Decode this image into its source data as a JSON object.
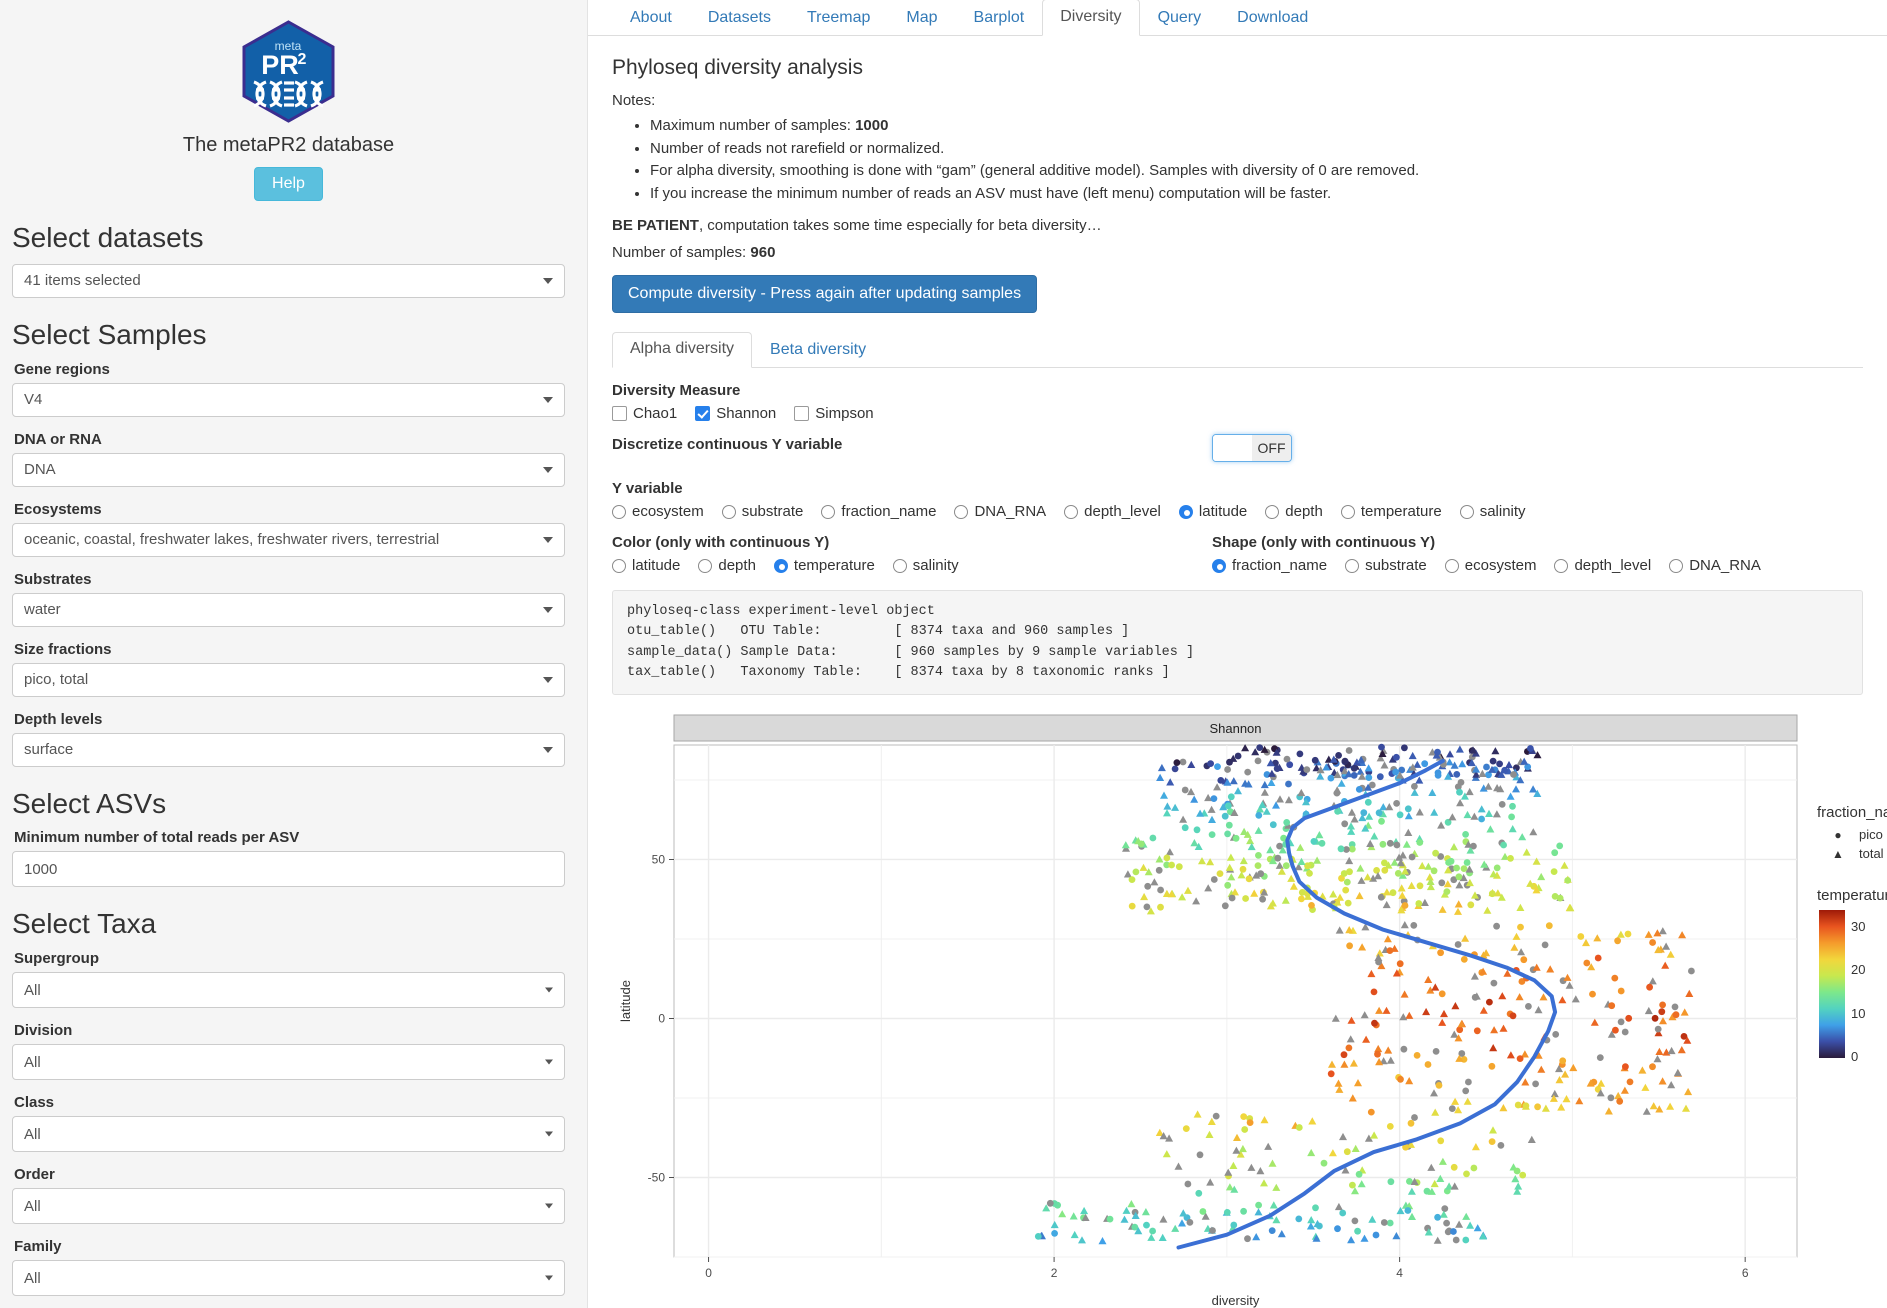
{
  "sidebar": {
    "brand_title": "The metaPR2 database",
    "logo_text": {
      "meta": "meta",
      "pr": "PR",
      "sup": "2"
    },
    "help_label": "Help",
    "sections": [
      {
        "title": "Select datasets"
      },
      {
        "title": "Select Samples"
      },
      {
        "title": "Select ASVs"
      },
      {
        "title": "Select Taxa"
      }
    ],
    "datasets_select": {
      "label": "",
      "value": "41 items selected"
    },
    "fields": [
      {
        "label": "Gene regions",
        "value": "V4",
        "type": "select"
      },
      {
        "label": "DNA or RNA",
        "value": "DNA",
        "type": "select"
      },
      {
        "label": "Ecosystems",
        "value": "oceanic, coastal, freshwater lakes, freshwater rivers, terrestrial",
        "type": "select"
      },
      {
        "label": "Substrates",
        "value": "water",
        "type": "select"
      },
      {
        "label": "Size fractions",
        "value": "pico, total",
        "type": "select"
      },
      {
        "label": "Depth levels",
        "value": "surface",
        "type": "select"
      }
    ],
    "asv_field": {
      "label": "Minimum number of total reads per ASV",
      "value": "1000"
    },
    "taxa_fields": [
      {
        "label": "Supergroup",
        "value": "All",
        "type": "select"
      },
      {
        "label": "Division",
        "value": "All",
        "type": "select"
      },
      {
        "label": "Class",
        "value": "All",
        "type": "select"
      },
      {
        "label": "Order",
        "value": "All",
        "type": "select"
      },
      {
        "label": "Family",
        "value": "All",
        "type": "select"
      }
    ]
  },
  "main": {
    "tabs": [
      {
        "label": "About",
        "active": false
      },
      {
        "label": "Datasets",
        "active": false
      },
      {
        "label": "Treemap",
        "active": false
      },
      {
        "label": "Map",
        "active": false
      },
      {
        "label": "Barplot",
        "active": false
      },
      {
        "label": "Diversity",
        "active": true
      },
      {
        "label": "Query",
        "active": false
      },
      {
        "label": "Download",
        "active": false
      }
    ],
    "heading": "Phyloseq diversity analysis",
    "notes_label": "Notes:",
    "notes": [
      "Maximum number of samples: 1000",
      "Number of reads not rarefield or normalized.",
      "For alpha diversity, smoothing is done with “gam” (general additive model). Samples with diversity of 0 are removed.",
      "If you increase the minimum number of reads an ASV must have (left menu) computation will be faster."
    ],
    "notes_bold_first": "1000",
    "be_patient_bold": "BE PATIENT",
    "be_patient_rest": ", computation takes some time especially for beta diversity…",
    "samples_label": "Number of samples: ",
    "samples_value": "960",
    "compute_button": "Compute diversity - Press again after updating samples",
    "subtabs": [
      {
        "label": "Alpha diversity",
        "active": true
      },
      {
        "label": "Beta diversity",
        "active": false
      }
    ],
    "diversity_measure": {
      "label": "Diversity Measure",
      "options": [
        {
          "label": "Chao1",
          "checked": false
        },
        {
          "label": "Shannon",
          "checked": true
        },
        {
          "label": "Simpson",
          "checked": false
        }
      ]
    },
    "discretize": {
      "label": "Discretize continuous Y variable",
      "state": "OFF"
    },
    "y_variable": {
      "label": "Y variable",
      "options": [
        {
          "label": "ecosystem",
          "checked": false
        },
        {
          "label": "substrate",
          "checked": false
        },
        {
          "label": "fraction_name",
          "checked": false
        },
        {
          "label": "DNA_RNA",
          "checked": false
        },
        {
          "label": "depth_level",
          "checked": false
        },
        {
          "label": "latitude",
          "checked": true
        },
        {
          "label": "depth",
          "checked": false
        },
        {
          "label": "temperature",
          "checked": false
        },
        {
          "label": "salinity",
          "checked": false
        }
      ]
    },
    "color_variable": {
      "label": "Color (only with continuous Y)",
      "options": [
        {
          "label": "latitude",
          "checked": false
        },
        {
          "label": "depth",
          "checked": false
        },
        {
          "label": "temperature",
          "checked": true
        },
        {
          "label": "salinity",
          "checked": false
        }
      ]
    },
    "shape_variable": {
      "label": "Shape (only with continuous Y)",
      "options": [
        {
          "label": "fraction_name",
          "checked": true
        },
        {
          "label": "substrate",
          "checked": false
        },
        {
          "label": "ecosystem",
          "checked": false
        },
        {
          "label": "depth_level",
          "checked": false
        },
        {
          "label": "DNA_RNA",
          "checked": false
        }
      ]
    },
    "phyloseq_output": "phyloseq-class experiment-level object\notu_table()   OTU Table:         [ 8374 taxa and 960 samples ]\nsample_data() Sample Data:       [ 960 samples by 9 sample variables ]\ntax_table()   Taxonomy Table:    [ 8374 taxa by 8 taxonomic ranks ]"
  },
  "chart_data": {
    "type": "scatter",
    "title": "Shannon",
    "xlabel": "diversity",
    "ylabel": "latitude",
    "xlim": [
      -0.2,
      6.3
    ],
    "ylim": [
      -75,
      86
    ],
    "xticks": [
      0,
      2,
      4,
      6
    ],
    "yticks": [
      -50,
      0,
      50
    ],
    "grid": true,
    "smoother": {
      "name": "gam",
      "color": "#3B6FD4",
      "points": [
        [
          2.72,
          -72
        ],
        [
          3.0,
          -68
        ],
        [
          3.25,
          -62
        ],
        [
          3.45,
          -55
        ],
        [
          3.62,
          -48
        ],
        [
          3.85,
          -42
        ],
        [
          4.1,
          -38
        ],
        [
          4.35,
          -33
        ],
        [
          4.55,
          -27
        ],
        [
          4.68,
          -20
        ],
        [
          4.78,
          -12
        ],
        [
          4.86,
          -4
        ],
        [
          4.9,
          2
        ],
        [
          4.88,
          7
        ],
        [
          4.78,
          12
        ],
        [
          4.62,
          16
        ],
        [
          4.4,
          20
        ],
        [
          4.15,
          24
        ],
        [
          3.9,
          28
        ],
        [
          3.68,
          33
        ],
        [
          3.52,
          38
        ],
        [
          3.42,
          43
        ],
        [
          3.38,
          48
        ],
        [
          3.36,
          52
        ],
        [
          3.35,
          56
        ],
        [
          3.38,
          60
        ],
        [
          3.45,
          63
        ],
        [
          3.6,
          66
        ],
        [
          3.8,
          70
        ],
        [
          4.0,
          74
        ],
        [
          4.15,
          78
        ],
        [
          4.25,
          81
        ]
      ]
    },
    "legends": [
      {
        "title": "fraction_name",
        "type": "shape",
        "entries": [
          {
            "label": "pico",
            "symbol": "circle"
          },
          {
            "label": "total",
            "symbol": "triangle"
          }
        ]
      },
      {
        "title": "temperature",
        "type": "colorbar",
        "ticks": [
          0,
          10,
          20,
          30
        ],
        "range": [
          -2,
          32
        ],
        "colors": [
          "#2B1B3A",
          "#3B4FA8",
          "#3FA0E8",
          "#53D3C0",
          "#7DE88B",
          "#C8E84E",
          "#F2D63C",
          "#F59B2B",
          "#E8541F",
          "#9E1A08"
        ]
      }
    ],
    "point_count": 960,
    "note": "Scatter of Shannon diversity vs latitude, colored by temperature, shaped by fraction_name"
  }
}
